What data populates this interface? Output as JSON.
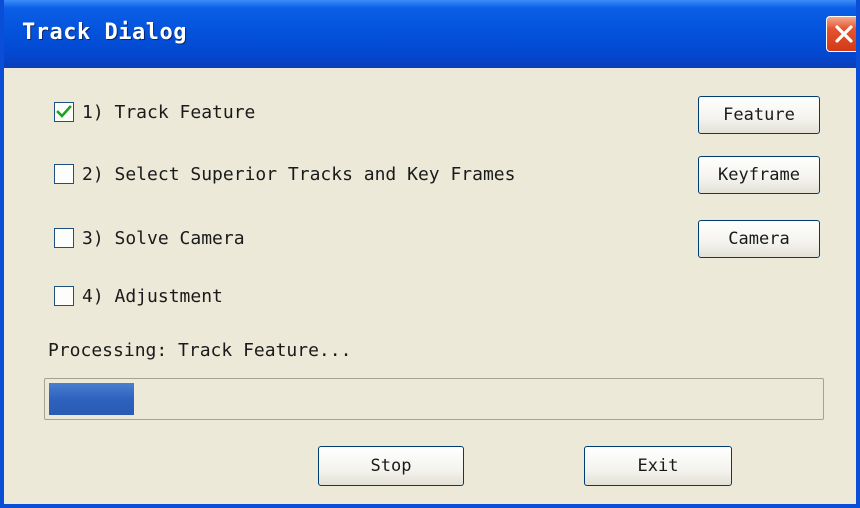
{
  "window": {
    "title": "Track Dialog",
    "close_icon": "close-icon"
  },
  "steps": [
    {
      "label": "1) Track Feature",
      "checked": true
    },
    {
      "label": "2) Select Superior Tracks and Key Frames",
      "checked": false
    },
    {
      "label": "3) Solve Camera",
      "checked": false
    },
    {
      "label": "4) Adjustment",
      "checked": false
    }
  ],
  "side_buttons": {
    "feature_label": "Feature",
    "keyframe_label": "Keyframe",
    "camera_label": "Camera"
  },
  "status": {
    "text": "Processing: Track Feature...",
    "progress_fraction": 0.11
  },
  "footer_buttons": {
    "stop_label": "Stop",
    "exit_label": "Exit"
  },
  "colors": {
    "titlebar": "#0453dc",
    "dialog_bg": "#ece9d8",
    "progress": "#2e62bf",
    "close_button": "#d23a16"
  }
}
